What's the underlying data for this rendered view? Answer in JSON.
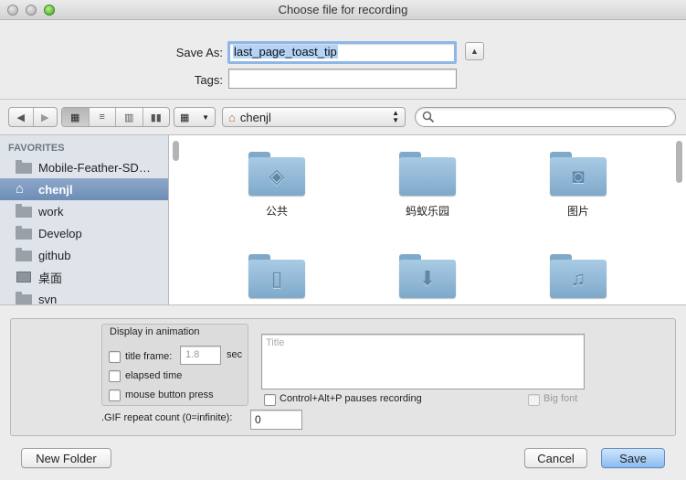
{
  "window": {
    "title": "Choose file for recording"
  },
  "save": {
    "save_as_label": "Save As:",
    "filename": "last_page_toast_tip",
    "tags_label": "Tags:",
    "tags_value": ""
  },
  "toolbar": {
    "location": "chenjl",
    "search_placeholder": ""
  },
  "sidebar": {
    "heading": "FAVORITES",
    "items": [
      {
        "label": "Mobile-Feather-SD…",
        "icon": "folder-icon"
      },
      {
        "label": "chenjl",
        "icon": "home-icon",
        "selected": true
      },
      {
        "label": "work",
        "icon": "folder-icon"
      },
      {
        "label": "Develop",
        "icon": "folder-icon"
      },
      {
        "label": "github",
        "icon": "folder-icon"
      },
      {
        "label": "桌面",
        "icon": "desktop-icon"
      },
      {
        "label": "svn",
        "icon": "folder-icon"
      }
    ]
  },
  "files": [
    {
      "label": "公共",
      "icon": "public-folder-icon"
    },
    {
      "label": "蚂蚁乐园",
      "icon": "folder-icon"
    },
    {
      "label": "图片",
      "icon": "pictures-folder-icon"
    },
    {
      "label": "",
      "icon": "documents-folder-icon"
    },
    {
      "label": "",
      "icon": "downloads-folder-icon"
    },
    {
      "label": "",
      "icon": "music-folder-icon"
    }
  ],
  "options": {
    "group_title": "Display in animation",
    "title_frame_label": "title frame:",
    "title_frame_value": "1.8",
    "sec_label": "sec",
    "elapsed_label": "elapsed time",
    "mouse_label": "mouse button press",
    "title_placeholder": "Title",
    "pause_label": "Control+Alt+P pauses recording",
    "big_font_label": "Big font",
    "gif_repeat_label": ".GIF repeat count (0=infinite):",
    "gif_repeat_value": "0"
  },
  "buttons": {
    "new_folder": "New Folder",
    "cancel": "Cancel",
    "save": "Save"
  },
  "colors": {
    "accent": "#8bbcf0",
    "sidebar_selected": "#6e8db7",
    "folder": "#a9cbe5"
  }
}
